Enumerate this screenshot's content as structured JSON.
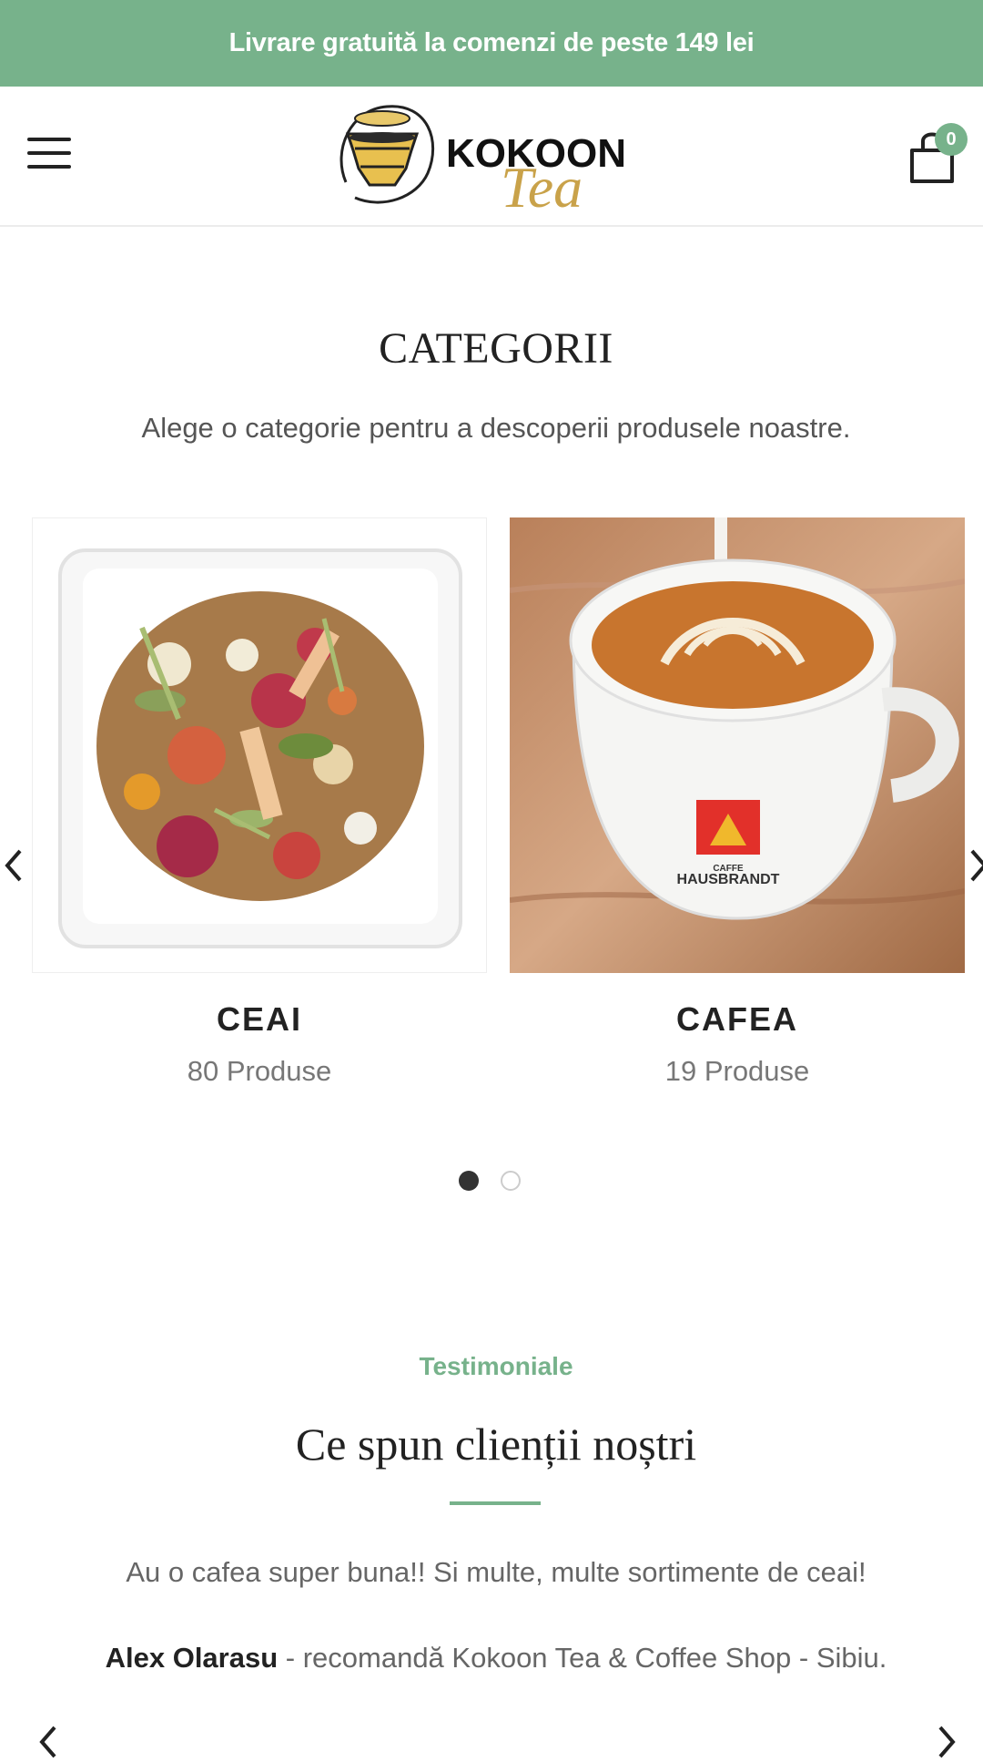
{
  "topbar": {
    "text": "Livrare gratuită la comenzi de peste 149 lei"
  },
  "header": {
    "logo_text": "KOKOON",
    "logo_script": "Tea",
    "cart_count": "0"
  },
  "categories": {
    "title": "CATEGORII",
    "subtitle": "Alege o categorie pentru a descoperii produsele noastre.",
    "items": [
      {
        "name": "CEAI",
        "count": "80 Produse"
      },
      {
        "name": "CAFEA",
        "count": "19 Produse"
      }
    ],
    "cup_brand_top": "CAFFE",
    "cup_brand": "HAUSBRANDT"
  },
  "testimonials": {
    "kicker": "Testimoniale",
    "title": "Ce spun clienții noștri",
    "quote": "Au o cafea super buna!! Si multe, multe sortimente de ceai!",
    "author": "Alex Olarasu",
    "author_suffix": " - recomandă Kokoon Tea & Coffee Shop - Sibiu."
  },
  "colors": {
    "accent": "#77b28b",
    "text_dark": "#222222"
  }
}
